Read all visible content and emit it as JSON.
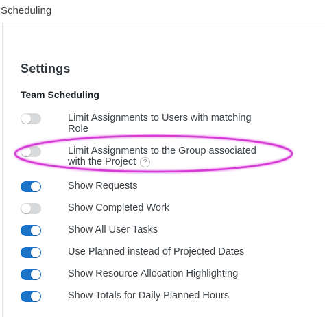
{
  "topbar": {
    "title": "Scheduling"
  },
  "settings": {
    "title": "Settings",
    "section_title": "Team Scheduling",
    "items": [
      {
        "label": "Limit Assignments to Users with matching Role",
        "enabled": false
      },
      {
        "label": "Limit Assignments to the Group associated with the Project",
        "enabled": false,
        "help_icon": "question-circle-icon",
        "help_glyph": "?"
      },
      {
        "label": "Show Requests",
        "enabled": true
      },
      {
        "label": "Show Completed Work",
        "enabled": false
      },
      {
        "label": "Show All User Tasks",
        "enabled": true
      },
      {
        "label": "Use Planned instead of Projected Dates",
        "enabled": true
      },
      {
        "label": "Show Resource Allocation Highlighting",
        "enabled": true
      },
      {
        "label": "Show Totals for Daily Planned Hours",
        "enabled": true
      }
    ]
  },
  "colors": {
    "toggle_on": "#1a73c9",
    "toggle_off": "#d7d9db",
    "highlight_annotation": "#d63bd6"
  }
}
